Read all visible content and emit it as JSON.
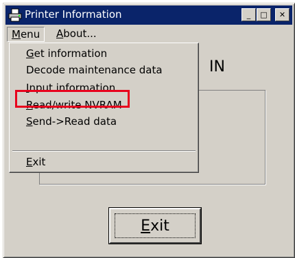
{
  "window": {
    "title": "Printer Information",
    "buttons": {
      "minimize": "_",
      "maximize": "□",
      "close": "✕"
    }
  },
  "menubar": {
    "menu": {
      "accel": "M",
      "rest": "enu"
    },
    "about": {
      "accel": "A",
      "rest": "bout..."
    }
  },
  "dropdown": {
    "items": [
      {
        "accel": "G",
        "rest": "et information"
      },
      {
        "accel": "",
        "rest": "Decode maintenance data"
      },
      {
        "accel": "I",
        "rest": "nput information"
      },
      {
        "accel": "R",
        "rest": "ead/write NVRAM"
      },
      {
        "accel": "S",
        "rest": "end->Read data"
      },
      {
        "accel": "E",
        "rest": "xit"
      }
    ]
  },
  "main": {
    "heading_fragment": "IN",
    "exit_button": {
      "accel": "E",
      "rest": "xit"
    }
  },
  "colors": {
    "titlebar": "#0a246a",
    "face": "#d4d0c8",
    "highlight": "#e8001c"
  },
  "icons": {
    "app": "printer-icon"
  }
}
